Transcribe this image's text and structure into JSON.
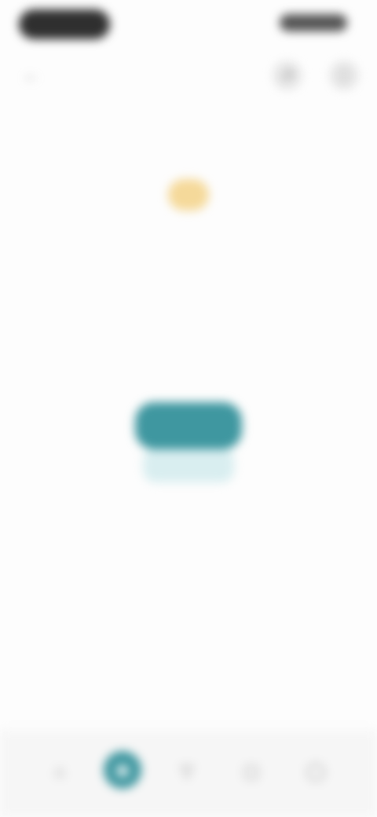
{
  "status_bar": {
    "time": "",
    "pill": ""
  },
  "app_bar": {
    "back_icon": "arrow-left-icon",
    "title": "",
    "actions": [
      {
        "icon": "share-icon",
        "glyph": "↗"
      },
      {
        "icon": "more-icon",
        "glyph": "⋮"
      }
    ]
  },
  "main": {
    "heading": "",
    "sun_icon": "sun-icon",
    "rows": [
      {
        "left": "",
        "right": ""
      },
      {
        "left": "",
        "right": ""
      }
    ],
    "center_text": "",
    "center_sub": "",
    "primary_button": "",
    "stats": [
      {
        "value": "",
        "label": ""
      },
      {
        "value": "",
        "label": ""
      }
    ],
    "footer_line": "",
    "footer_sub": ""
  },
  "bottom_nav": {
    "items": [
      {
        "icon": "home-icon",
        "glyph": "⌂",
        "active": false
      },
      {
        "icon": "explore-icon",
        "glyph": "◉",
        "active": true
      },
      {
        "icon": "lightbulb-icon",
        "glyph": "▽",
        "active": false
      },
      {
        "icon": "chat-icon",
        "glyph": "▢",
        "active": false
      },
      {
        "icon": "profile-icon",
        "glyph": "◯",
        "active": false
      }
    ]
  },
  "colors": {
    "accent": "#3f97a0",
    "accent_light": "#d9eef0",
    "sun": "#f5d99a",
    "background": "#fdfdfd"
  }
}
